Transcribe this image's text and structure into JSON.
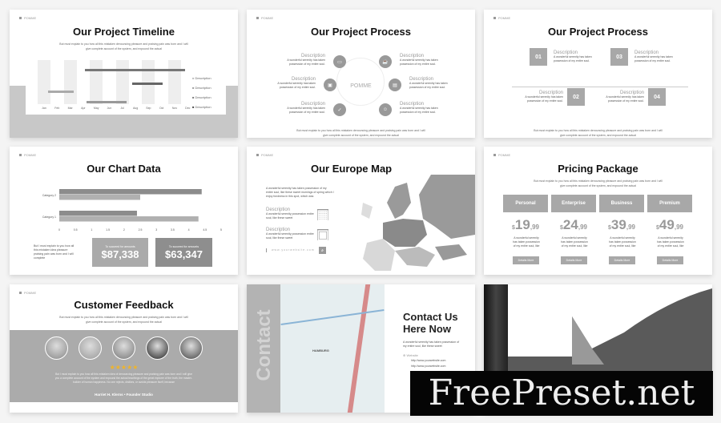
{
  "brand": "POMME",
  "lorem": "But must explain to you how all this mistaken denouncing pleasure and praising pain was born and I will give complete account of the system, and expound the actual",
  "desc_text": "A wonderful serenity has taken possession of my entire soul.",
  "timeline": {
    "title": "Our Project Timeline",
    "months": [
      "Jan",
      "Feb",
      "Mar",
      "Apr",
      "May",
      "Jun",
      "Jul",
      "Aug",
      "Sep",
      "Oct",
      "Nov",
      "Dec"
    ],
    "legend": [
      "Description",
      "Description",
      "Description",
      "Description"
    ]
  },
  "process1": {
    "title": "Our Project Process",
    "center": "POMME",
    "items": [
      {
        "label": "Description"
      },
      {
        "label": "Description"
      },
      {
        "label": "Description"
      },
      {
        "label": "Description"
      },
      {
        "label": "Description"
      },
      {
        "label": "Description"
      }
    ]
  },
  "process2": {
    "title": "Our Project Process",
    "steps": [
      {
        "num": "01",
        "label": "Description"
      },
      {
        "num": "02",
        "label": "Description"
      },
      {
        "num": "03",
        "label": "Description"
      },
      {
        "num": "04",
        "label": "Description"
      }
    ]
  },
  "chart": {
    "title": "Our Chart Data",
    "text": "But I must explain to you how all this mistaken idea pleasure praising pain was born and I will complete",
    "stats": [
      {
        "label": "To succeed for amounts",
        "value": "$87,338"
      },
      {
        "label": "To succeed for amounts",
        "value": "$63,347"
      }
    ]
  },
  "chart_data": {
    "type": "bar",
    "orientation": "horizontal",
    "categories": [
      "Category 2",
      "Category 1"
    ],
    "series": [
      {
        "values": [
          4.4,
          2.4
        ]
      },
      {
        "values": [
          2.5,
          4.3
        ]
      }
    ],
    "xticks": [
      "0",
      "0.5",
      "1",
      "1.5",
      "2",
      "2.5",
      "3",
      "3.5",
      "4",
      "4.5",
      "5"
    ],
    "xlim": [
      0,
      5
    ],
    "colors": [
      "#8c8c8c",
      "#b0b0b0"
    ]
  },
  "europe": {
    "title": "Our Europe Map",
    "intro": "A wonderful serenity has taken possession of my entire soul, like these sweet mornings of spring which I enjoy fondness in this spot, which was",
    "items": [
      {
        "label": "Description",
        "text": "A wonderful serenity possession entire soul, like these sweet"
      },
      {
        "label": "Description",
        "text": "A wonderful serenity possession entire soul, like these sweet"
      }
    ],
    "url": "www.yourwebsite.com"
  },
  "pricing": {
    "title": "Pricing Package",
    "plans": [
      {
        "name": "Personal",
        "price": "19",
        "cents": ",99"
      },
      {
        "name": "Enterprise",
        "price": "24",
        "cents": ",99"
      },
      {
        "name": "Business",
        "price": "39",
        "cents": ",99"
      },
      {
        "name": "Premium",
        "price": "49",
        "cents": ",99"
      }
    ],
    "currency": "$",
    "plan_text": "A wonderful serenity has taken possession of my entire soul, like",
    "button": "Details More"
  },
  "feedback": {
    "title": "Customer Feedback",
    "stars": 5,
    "star_color": "#f0b429",
    "quote": "But I must explain to you how all this mistaken idea of denouncing pleasure and praising pain was born and I will give you a complete account of the system and expound the actual teachings of the great explorer of the truth, the master-builder of human happiness. No one rejects, dislikes, or avoids pleasure itself, because",
    "author": "Harriet H. Klerns • Founder Studio"
  },
  "contact": {
    "side": "Contact",
    "map_label": "HAMBURG",
    "title_line1": "Contact Us",
    "title_line2": "Here Now",
    "text": "A wonderful serenity has taken possession of my entire soul, like these sweet",
    "website_label": "Website",
    "urls": [
      "http://www.yourwebsite.com",
      "http://www.yourwebsite.com"
    ]
  },
  "watermark": "FreePreset.net"
}
